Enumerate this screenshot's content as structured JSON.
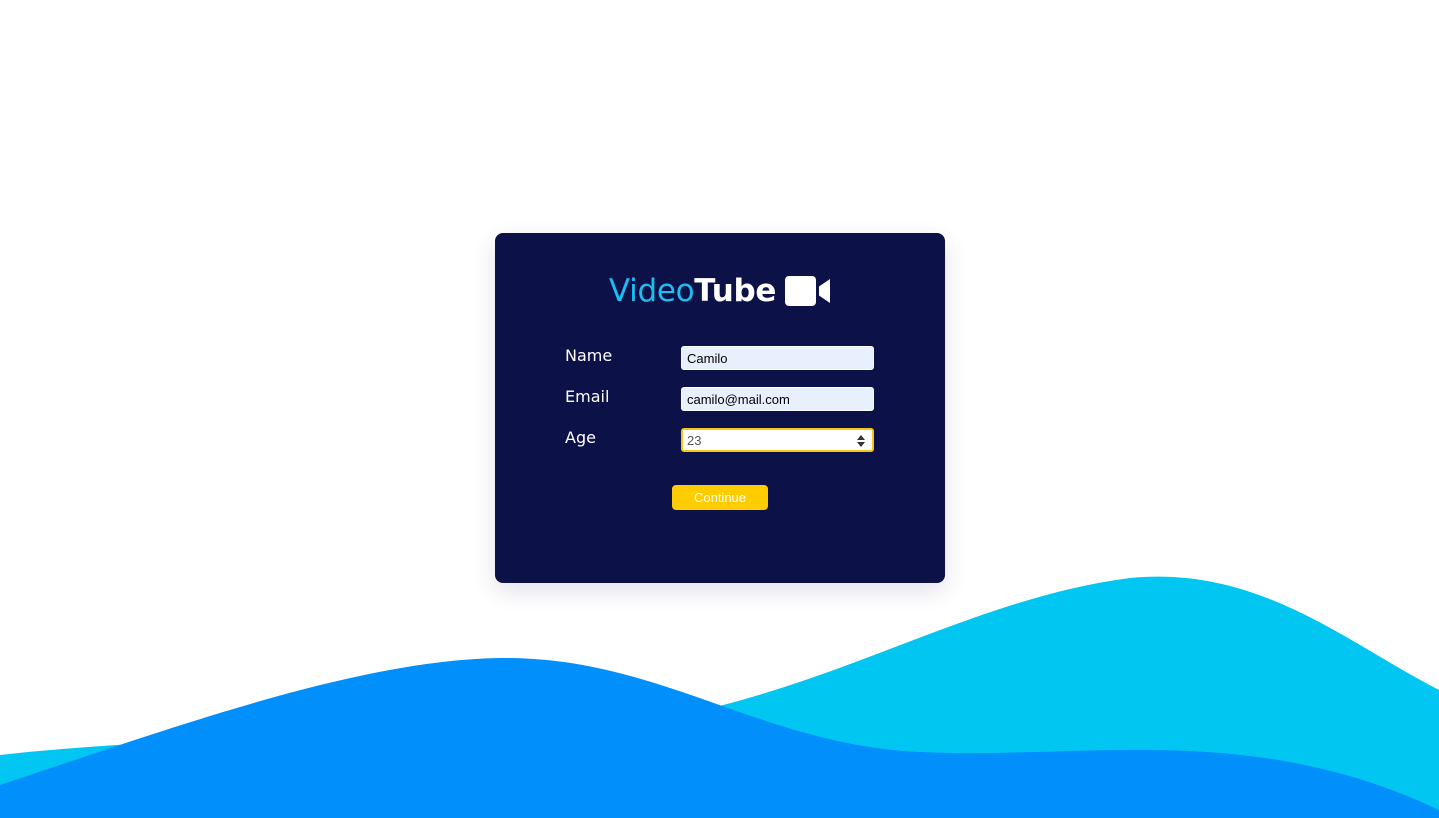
{
  "brand": {
    "name_part_1": "Video",
    "name_part_2": "Tube",
    "icon": "video-camera-icon"
  },
  "form": {
    "fields": [
      {
        "label": "Name",
        "value": "Camilo",
        "type": "text"
      },
      {
        "label": "Email",
        "value": "camilo@mail.com",
        "type": "email"
      },
      {
        "label": "Age",
        "value": "23",
        "type": "number"
      }
    ],
    "submit_label": "Continue"
  },
  "colors": {
    "card_background": "#0c1147",
    "brand_accent": "#1cbdf0",
    "button": "#ffcc00",
    "focus_border": "#f5c518",
    "wave_light": "#00c6f1",
    "wave_dark": "#008ffb"
  }
}
